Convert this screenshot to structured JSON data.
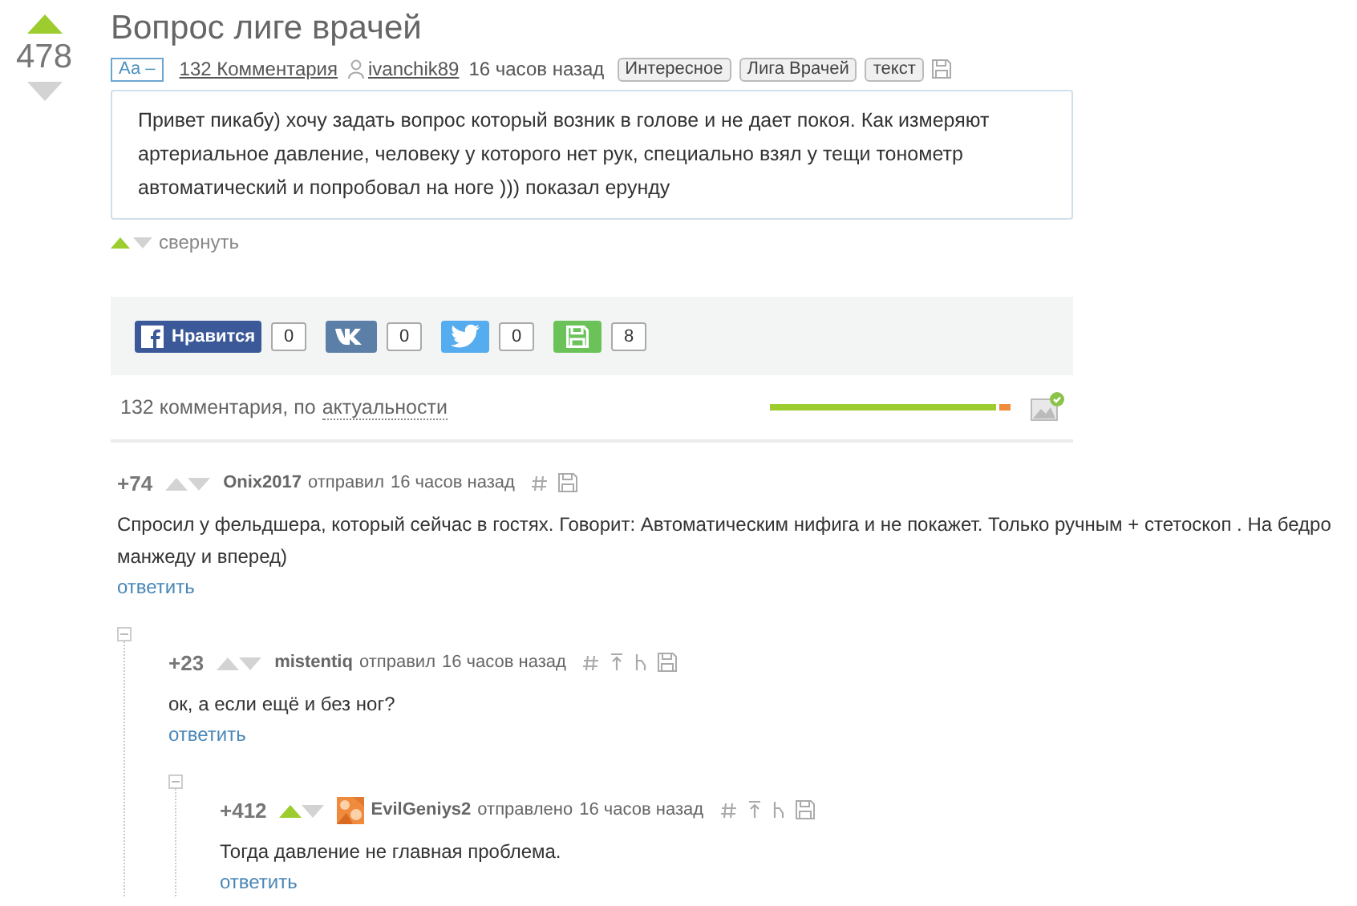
{
  "post": {
    "rating": "478",
    "voted_up": true,
    "title": "Вопрос лиге врачей",
    "font_toggle": "Аа –",
    "comments_link": "132 Комментария",
    "author": "ivanchik89",
    "time": "16 часов назад",
    "tags": [
      "Интересное",
      "Лига Врачей",
      "текст"
    ],
    "text": "Привет пикабу) хочу задать вопрос который возник в голове и не дает покоя. Как измеряют артериальное давление, человеку у которого нет рук, специально взял у тещи тонометр автоматический и попробовал на ноге )))  показал ерунду",
    "collapse_label": "свернуть"
  },
  "share": [
    {
      "kind": "facebook",
      "label": "Нравится",
      "count": "0"
    },
    {
      "kind": "vk",
      "count": "0"
    },
    {
      "kind": "twitter",
      "count": "0"
    },
    {
      "kind": "save",
      "count": "8"
    }
  ],
  "comments_header": {
    "count_text": "132 комментария, по",
    "sort": "актуальности",
    "level": 0.94
  },
  "comments": [
    {
      "rating": "+74",
      "voted_up": false,
      "avatar": false,
      "author": "Onix2017",
      "action": "отправил",
      "time": "16 часов назад",
      "text": "Спросил у фельдшера, который сейчас в гостях. Говорит: Автоматическим нифига и не покажет. Только ручным + стетоскоп . На бедро манжеду и вперед)",
      "reply": "ответить",
      "children": [
        {
          "rating": "+23",
          "voted_up": false,
          "avatar": false,
          "author": "mistentiq",
          "action": "отправил",
          "time": "16 часов назад",
          "text": "ок, а если ещё и без ног?",
          "reply": "ответить",
          "children": [
            {
              "rating": "+412",
              "voted_up": true,
              "avatar": true,
              "author": "EvilGeniys2",
              "action": "отправлено",
              "time": "16 часов назад",
              "text": "Тогда давление не главная проблема.",
              "reply": "ответить"
            }
          ]
        }
      ]
    }
  ]
}
